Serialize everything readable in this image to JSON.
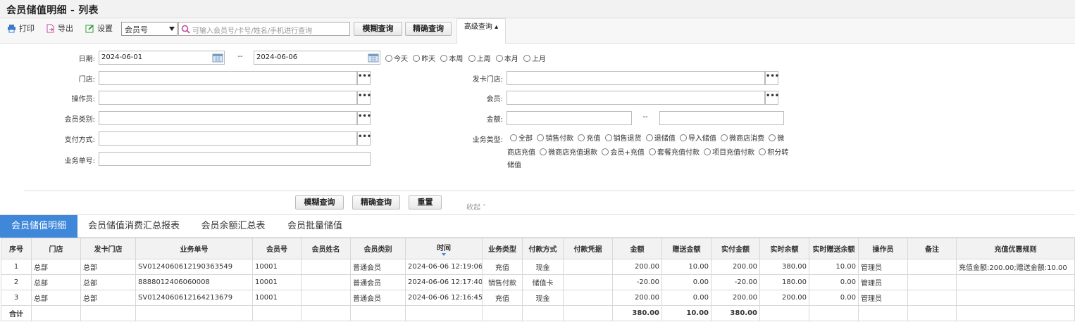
{
  "page": {
    "title": "会员储值明细 - 列表"
  },
  "toolbar": {
    "print_label": "打印",
    "export_label": "导出",
    "settings_label": "设置",
    "search_field": "会员号",
    "search_placeholder": "可输入会员号/卡号/姓名/手机进行查询",
    "fuzzy_label": "模糊查询",
    "exact_label": "精确查询",
    "advanced_label": "高级查询 ▴"
  },
  "filters": {
    "date_label": "日期:",
    "date_from": "2024-06-01",
    "date_sep": "--",
    "date_to": "2024-06-06",
    "date_quick": [
      "今天",
      "昨天",
      "本周",
      "上周",
      "本月",
      "上月"
    ],
    "store_label": "门店:",
    "issue_store_label": "发卡门店:",
    "operator_label": "操作员:",
    "member_label": "会员:",
    "member_type_label": "会员类别:",
    "amount_label": "金额:",
    "amount_sep": "--",
    "payment_label": "支付方式:",
    "biz_type_label": "业务类型:",
    "biz_no_label": "业务单号:",
    "biz_line1": [
      "全部",
      "销售付款",
      "充值",
      "销售退货",
      "退储值",
      "导入储值",
      "微商店消费",
      "微"
    ],
    "biz_line2_pre": "商店充值",
    "biz_line2": [
      "微商店充值退款",
      "会员+充值",
      "套餐充值付款",
      "项目充值付款",
      "积分转"
    ],
    "biz_line3": "储值",
    "dots": "•••",
    "fuzzy_label": "模糊查询",
    "exact_label": "精确查询",
    "reset_label": "重置",
    "collapse_label": "收起 ˄"
  },
  "tabs": [
    "会员储值明细",
    "会员储值消费汇总报表",
    "会员余额汇总表",
    "会员批量储值"
  ],
  "table": {
    "headers": [
      "序号",
      "门店",
      "发卡门店",
      "业务单号",
      "会员号",
      "会员姓名",
      "会员类别",
      "时间",
      "业务类型",
      "付款方式",
      "付款凭据",
      "金额",
      "赠送金额",
      "实付金额",
      "实时余额",
      "实时赠送余额",
      "操作员",
      "备注",
      "充值优惠规则"
    ],
    "rows": [
      [
        "1",
        "总部",
        "总部",
        "SV0124060612190363549",
        "10001",
        "",
        "普通会员",
        "2024-06-06 12:19:06",
        "充值",
        "现金",
        "",
        "200.00",
        "10.00",
        "200.00",
        "380.00",
        "10.00",
        "管理员",
        "",
        "充值金额:200.00;赠送金额:10.00"
      ],
      [
        "2",
        "总部",
        "总部",
        "8888012406060008",
        "10001",
        "",
        "普通会员",
        "2024-06-06 12:17:40",
        "销售付款",
        "储值卡",
        "",
        "-20.00",
        "0.00",
        "-20.00",
        "180.00",
        "0.00",
        "管理员",
        "",
        ""
      ],
      [
        "3",
        "总部",
        "总部",
        "SV0124060612164213679",
        "10001",
        "",
        "普通会员",
        "2024-06-06 12:16:45",
        "充值",
        "现金",
        "",
        "200.00",
        "0.00",
        "200.00",
        "200.00",
        "0.00",
        "管理员",
        "",
        ""
      ]
    ],
    "total": [
      "合计",
      "",
      "",
      "",
      "",
      "",
      "",
      "",
      "",
      "",
      "",
      "380.00",
      "10.00",
      "380.00",
      "",
      "",
      "",
      "",
      ""
    ]
  },
  "colors": {
    "accent": "#3f87d9",
    "print_icon": "#3a7ac8",
    "export_icon": "#c04aa0",
    "settings_icon": "#2e9a3a"
  }
}
